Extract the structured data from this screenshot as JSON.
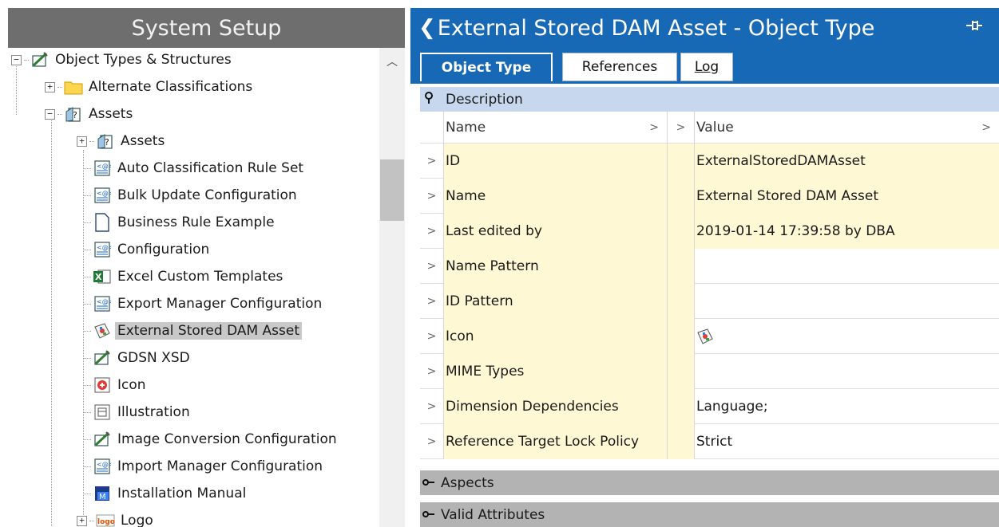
{
  "left_pane": {
    "title": "System Setup",
    "tree": [
      {
        "label": "Object Types & Structures",
        "expander": "−",
        "icon": "object-type-icon"
      },
      {
        "label": "Alternate Classifications",
        "expander": "+",
        "icon": "folder-icon"
      },
      {
        "label": "Assets",
        "expander": "−",
        "icon": "asset-type-icon"
      },
      {
        "label": "Assets",
        "expander": "+",
        "icon": "asset-type-icon"
      },
      {
        "label": "Auto Classification Rule Set",
        "icon": "config-icon"
      },
      {
        "label": "Bulk Update Configuration",
        "icon": "config-icon"
      },
      {
        "label": "Business Rule Example",
        "icon": "document-icon"
      },
      {
        "label": "Configuration",
        "icon": "config-icon"
      },
      {
        "label": "Excel Custom Templates",
        "icon": "excel-icon"
      },
      {
        "label": "Export Manager Configuration",
        "icon": "config-icon"
      },
      {
        "label": "External Stored DAM Asset",
        "icon": "dam-asset-icon",
        "selected": true
      },
      {
        "label": "GDSN XSD",
        "icon": "object-type-icon"
      },
      {
        "label": "Icon",
        "icon": "icon-asset-icon"
      },
      {
        "label": "Illustration",
        "icon": "illustration-icon"
      },
      {
        "label": "Image Conversion Configuration",
        "icon": "object-type-icon"
      },
      {
        "label": "Import Manager Configuration",
        "icon": "config-icon"
      },
      {
        "label": "Installation Manual",
        "icon": "manual-icon"
      },
      {
        "label": "Logo",
        "expander": "+",
        "icon": "logo-icon"
      }
    ]
  },
  "right_pane": {
    "title": "External Stored DAM Asset - Object Type",
    "back_glyph": "❮",
    "tabs": [
      {
        "label": "Object Type",
        "active": true
      },
      {
        "label": "References"
      },
      {
        "label": "Log"
      }
    ],
    "description_section": "Description",
    "grid_header": {
      "name": "Name",
      "value": "Value"
    },
    "rows": [
      {
        "name": "ID",
        "value": "ExternalStoredDAMAsset",
        "yellow": true
      },
      {
        "name": "Name",
        "value": "External Stored DAM Asset",
        "yellow": true
      },
      {
        "name": "Last edited by",
        "value": "2019-01-14 17:39:58 by DBA",
        "yellow": true
      },
      {
        "name": "Name Pattern",
        "value": ""
      },
      {
        "name": "ID Pattern",
        "value": ""
      },
      {
        "name": "Icon",
        "value": "",
        "icon": "dam-asset-icon"
      },
      {
        "name": "MIME Types",
        "value": ""
      },
      {
        "name": "Dimension Dependencies",
        "value": "Language;"
      },
      {
        "name": "Reference Target Lock Policy",
        "value": "Strict"
      }
    ],
    "aspects_section": "Aspects",
    "valid_attributes_section": "Valid Attributes"
  }
}
